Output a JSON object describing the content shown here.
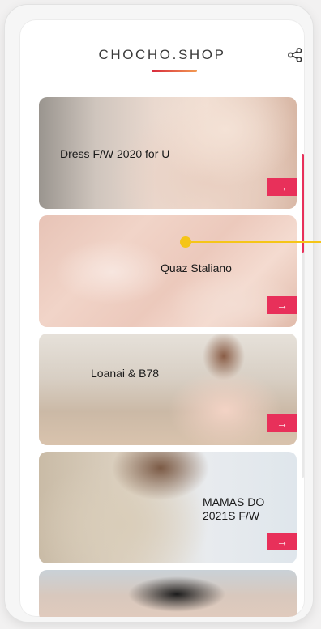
{
  "header": {
    "brand": "CHOCHO.SHOP",
    "share_icon": "share-icon"
  },
  "cards": [
    {
      "title": "Dress F/W 2020 for U",
      "arrow": "→"
    },
    {
      "title": "Quaz Staliano",
      "arrow": "→"
    },
    {
      "title": "Loanai & B78",
      "arrow": "→"
    },
    {
      "title_line1": "MAMAS DO",
      "title_line2": "2021S F/W",
      "arrow": "→"
    },
    {
      "title": ""
    }
  ],
  "colors": {
    "accent": "#e8305a",
    "brand_gradient_start": "#d82a3d",
    "brand_gradient_end": "#f29a52",
    "pointer": "#f5c518"
  }
}
